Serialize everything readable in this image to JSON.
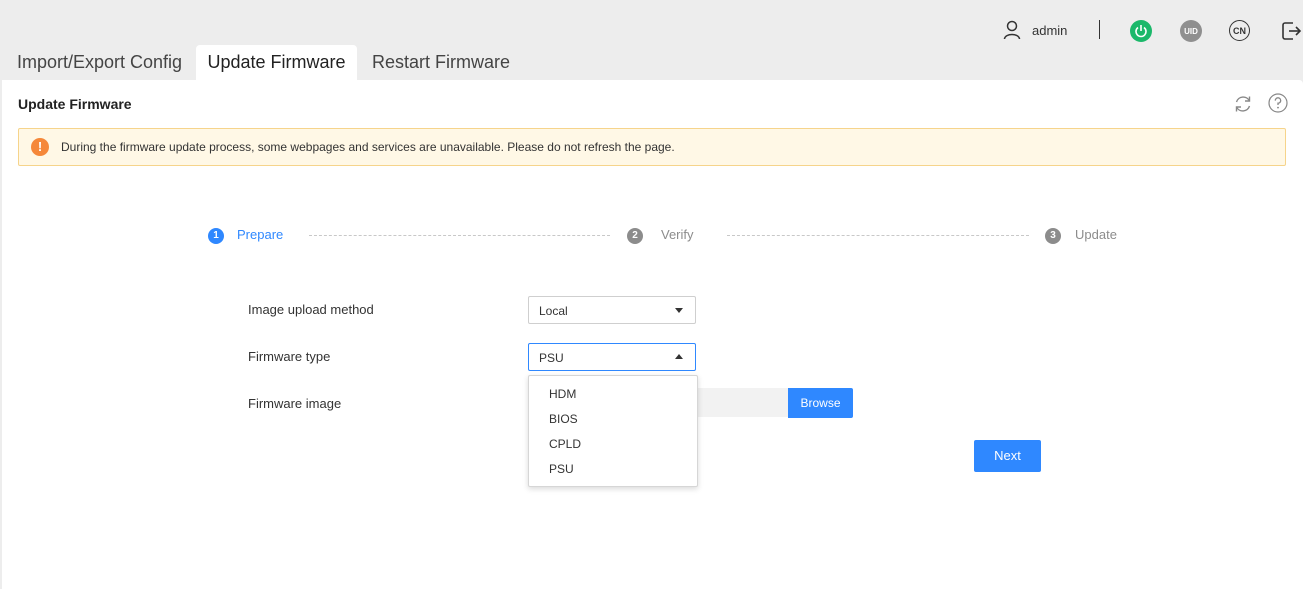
{
  "header": {
    "username": "admin",
    "uid_label": "UID",
    "lang_label": "CN",
    "colors": {
      "power": "#1bb86a",
      "uid": "#8f8f8f"
    }
  },
  "tabs": [
    {
      "label": "Import/Export Config",
      "active": false
    },
    {
      "label": "Update Firmware",
      "active": true
    },
    {
      "label": "Restart Firmware",
      "active": false
    }
  ],
  "panel": {
    "title": "Update Firmware",
    "alert": {
      "icon": "!",
      "text": "During the firmware update process, some webpages and services are unavailable. Please do not refresh the page."
    }
  },
  "steps": [
    {
      "num": "1",
      "label": "Prepare",
      "state": "active"
    },
    {
      "num": "2",
      "label": "Verify",
      "state": "pending"
    },
    {
      "num": "3",
      "label": "Update",
      "state": "pending"
    }
  ],
  "form": {
    "upload_method": {
      "label": "Image upload method",
      "value": "Local"
    },
    "firmware_type": {
      "label": "Firmware type",
      "value": "PSU",
      "options": [
        "HDM",
        "BIOS",
        "CPLD",
        "PSU"
      ]
    },
    "firmware_image": {
      "label": "Firmware image",
      "browse_label": "Browse"
    },
    "next_label": "Next"
  },
  "accent_color": "#2f88ff"
}
